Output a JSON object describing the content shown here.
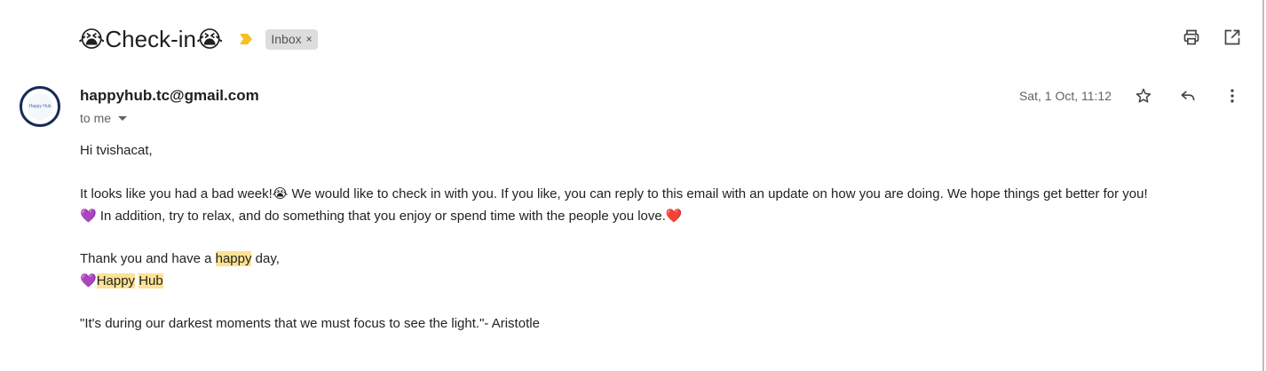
{
  "email": {
    "subject": "Check-in",
    "subject_emoji": "😭",
    "label": "Inbox",
    "label_remove": "×",
    "sender": "happyhub.tc@gmail.com",
    "recipient": "to me",
    "date": "Sat, 1 Oct, 11:12",
    "avatar_text": "Happy Hub"
  },
  "toolbar": {
    "print_icon": "printer-icon",
    "new_window_icon": "open-in-new-window-icon",
    "star_icon": "star-icon",
    "reply_icon": "reply-icon",
    "more_icon": "more-vert-icon"
  },
  "body": {
    "greeting": "Hi tvishacat,",
    "p1_part1": "It looks like you had a bad week!",
    "crying_emoji": "😭",
    "p1_part2": " We would like to check in with you. If you like, you can reply to this email with an update on how you are doing. We hope things get better for you!",
    "purple_heart": "💜",
    "p1_part3": " In addition, try to relax, and do something that you enjoy or spend time with the people you love.",
    "red_heart": "❤️",
    "thanks_part1": "Thank you and have a ",
    "thanks_highlight": "happy",
    "thanks_part2": " day,",
    "signature_happy": "Happy",
    "signature_hub": "Hub",
    "quote": "\"It's during our darkest moments that we must focus to see the light.\"- Aristotle"
  },
  "colors": {
    "highlight": "#fde293",
    "importance_marker": "#f6c026",
    "avatar_ring": "#152a55"
  }
}
